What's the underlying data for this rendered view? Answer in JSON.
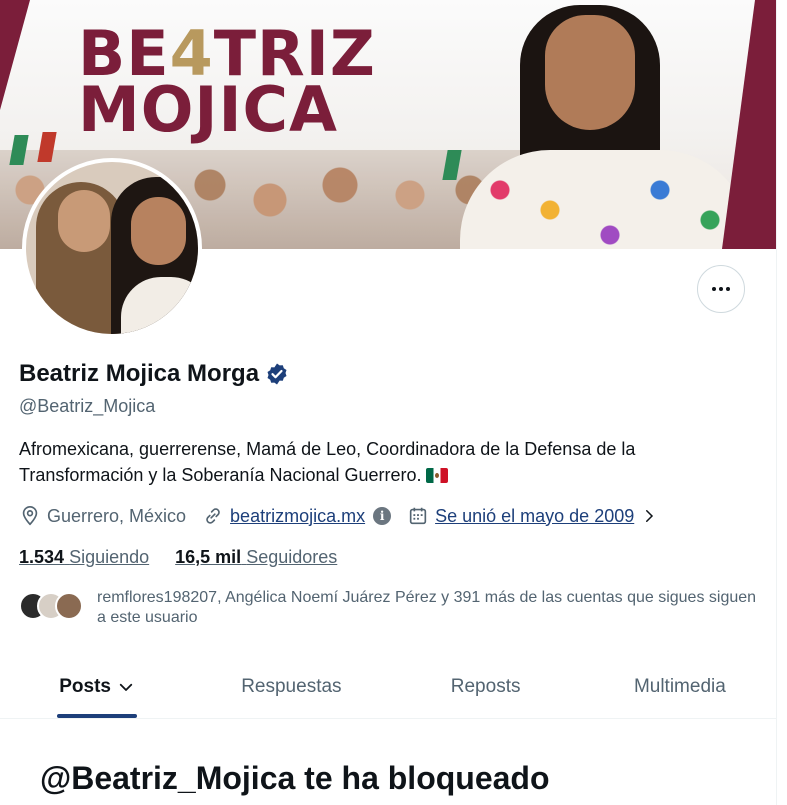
{
  "banner": {
    "title_line1_a": "BE",
    "title_line1_b": "4",
    "title_line1_c": "TRIZ",
    "title_line2": "MOJICA",
    "brand_color": "#7b1e3a"
  },
  "profile": {
    "display_name": "Beatriz Mojica Morga",
    "handle": "@Beatriz_Mojica",
    "bio": "Afromexicana, guerrerense, Mamá de Leo, Coordinadora de la Defensa de la Transformación y la Soberanía Nacional Guerrero.",
    "location": "Guerrero, México",
    "website": "beatrizmojica.mx",
    "joined": "Se unió el mayo de 2009",
    "following_count": "1.534",
    "following_label": "Siguiendo",
    "followers_count": "16,5 mil",
    "followers_label": "Seguidores",
    "followers_you_know": "remflores198207, Angélica Noemí Juárez Pérez y 391 más de las cuentas que sigues siguen a este usuario",
    "verified_color": "#1d9bf0"
  },
  "icons": {
    "more": "more-icon",
    "location": "location-pin-icon",
    "link": "link-icon",
    "calendar": "calendar-icon",
    "verified": "verified-badge-icon"
  },
  "tabs": [
    {
      "label": "Posts",
      "active": true
    },
    {
      "label": "Respuestas",
      "active": false
    },
    {
      "label": "Reposts",
      "active": false
    },
    {
      "label": "Multimedia",
      "active": false
    }
  ],
  "blocked_message": "@Beatriz_Mojica te ha bloqueado"
}
